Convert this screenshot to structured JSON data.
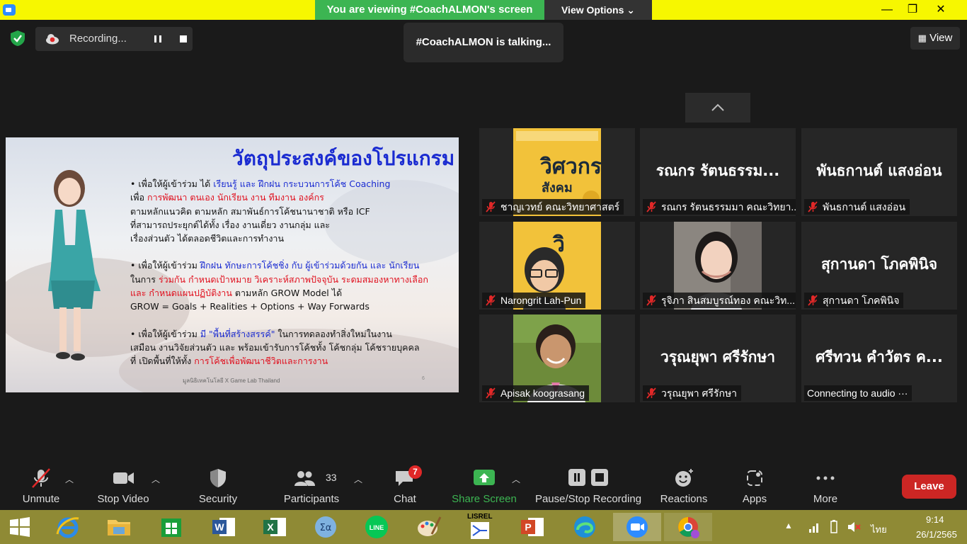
{
  "window": {
    "banner": "You are viewing #CoachALMON's screen",
    "view_options": "View Options",
    "minimize": "—",
    "restore": "❐",
    "close": "✕"
  },
  "recording": {
    "label": "Recording..."
  },
  "talking": "#CoachALMON is talking...",
  "view_button": "View",
  "slide": {
    "title": "วัตถุประสงค์ของโปรแกรม",
    "para1": [
      {
        "t": "• เพื่อให้ผู้เข้าร่วม ได้ ",
        "c": ""
      },
      {
        "t": "เรียนรู้ และ ฝึกฝน กระบวนการโค้ช Coaching",
        "c": "b"
      },
      {
        "t": "\nเพื่อ ",
        "c": ""
      },
      {
        "t": "การพัฒนา ตนเอง นักเรียน งาน ทีมงาน องค์กร",
        "c": "r"
      },
      {
        "t": "\nตามหลักแนวคิด ตามหลัก สมาพันธ์การโค้ชนานาชาติ หรือ ICF\nที่สามารถประยุกต์ได้ทั้ง เรื่อง งานเดี่ยว งานกลุ่ม และ\nเรื่องส่วนตัว ได้ตลอดชีวิตและการทำงาน",
        "c": ""
      }
    ],
    "para2": [
      {
        "t": "• เพื่อให้ผู้เข้าร่วม ",
        "c": ""
      },
      {
        "t": "ฝึกฝน ทักษะการโค้ชชิ่ง กับ ผู้เข้าร่วมด้วยกัน และ นักเรียน",
        "c": "b"
      },
      {
        "t": "\nในการ ",
        "c": ""
      },
      {
        "t": "ร่วมกัน กำหนดเป้าหมาย วิเคราะห์สภาพปัจจุบัน ระดมสมองหาทางเลือก\nและ กำหนดแผนปฏิบัติงาน",
        "c": "r"
      },
      {
        "t": " ตามหลัก GROW Model ได้\nGROW = Goals + Realities + Options + Way Forwards",
        "c": ""
      }
    ],
    "para3": [
      {
        "t": "• เพื่อให้ผู้เข้าร่วม ",
        "c": ""
      },
      {
        "t": "มี \"พื้นที่สร้างสรรค์\"",
        "c": "b"
      },
      {
        "t": " ในการทดลองทำสิ่งใหม่ในงาน\nเสมือน งานวิจัยส่วนตัว และ พร้อมเข้ารับการโค้ชทั้ง โค้ชกลุ่ม โค้ชรายบุคคล\nที่ เปิดพื้นที่ให้ทั้ง ",
        "c": ""
      },
      {
        "t": "การโค้ชเพื่อพัฒนาชีวิตและการงาน",
        "c": "r"
      }
    ],
    "footer": "มูลนิธิเทคโนโลยี X Game Lab Thailand",
    "page": "6"
  },
  "participants_tiles": [
    {
      "big": "",
      "label": "ชาญเวทย์ คณะวิทยาศาสตร์",
      "muted": true,
      "pic": "book"
    },
    {
      "big": "รณกร รัตนธรรม...",
      "label": "รณกร รัตนธรรมมา คณะวิทยา...",
      "muted": true,
      "pic": ""
    },
    {
      "big": "พันธกานต์ แสงอ่อน",
      "label": "พันธกานต์ แสงอ่อน",
      "muted": true,
      "pic": ""
    },
    {
      "big": "",
      "label": "Narongrit Lah-Pun",
      "muted": true,
      "pic": "avatar"
    },
    {
      "big": "",
      "label": "รุจิภา สินสมบูรณ์ทอง คณะวิท...",
      "muted": true,
      "pic": "woman"
    },
    {
      "big": "สุกานดา โภคพินิจ",
      "label": "สุกานดา โภคพินิจ",
      "muted": true,
      "pic": ""
    },
    {
      "big": "",
      "label": "Apisak koograsang",
      "muted": true,
      "pic": "man"
    },
    {
      "big": "วรุณยุพา ศรีรักษา",
      "label": "วรุณยุพา ศรีรักษา",
      "muted": true,
      "pic": ""
    },
    {
      "big": "ศรีทวน คำวัตร ค...",
      "label": "Connecting to audio ···",
      "muted": false,
      "pic": ""
    }
  ],
  "book": {
    "title_line1": "วิศวกร",
    "title_line2": "สังคม"
  },
  "toolbar": {
    "unmute": "Unmute",
    "stop_video": "Stop Video",
    "security": "Security",
    "participants": "Participants",
    "participants_count": "33",
    "chat": "Chat",
    "chat_badge": "7",
    "share_screen": "Share Screen",
    "pause_stop_recording": "Pause/Stop Recording",
    "reactions": "Reactions",
    "apps": "Apps",
    "more": "More",
    "leave": "Leave"
  },
  "taskbar": {
    "language": "ไทย",
    "time": "9:14",
    "date": "26/1/2565",
    "lisrel": "LISREL"
  },
  "colors": {
    "titlebar": "#f7f700",
    "banner_green": "#3cb552",
    "leave_red": "#cc2624",
    "slide_title_blue": "#1a2bd1",
    "slide_red": "#e0101e",
    "taskbar": "#8f8a35"
  }
}
